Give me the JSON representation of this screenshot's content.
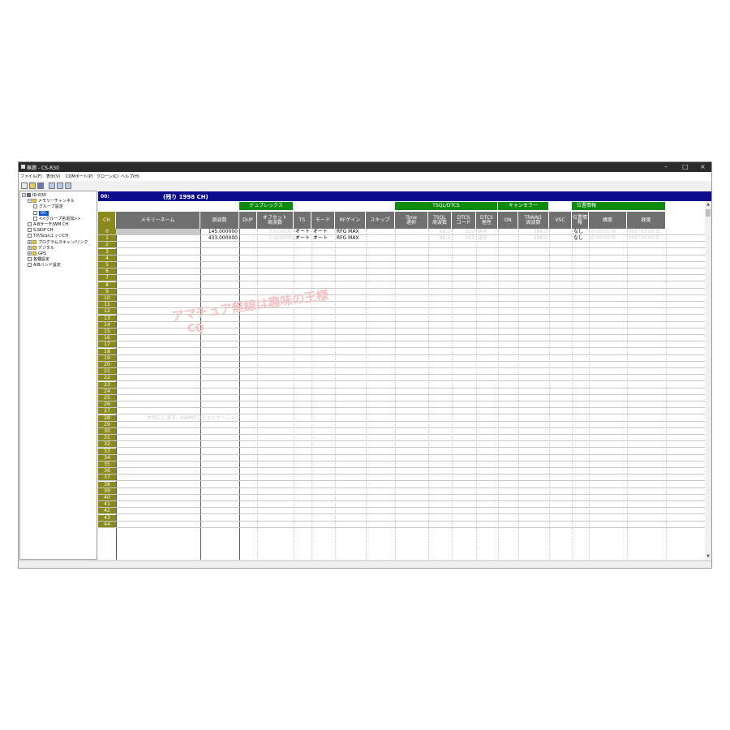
{
  "window": {
    "title": "無題 - CS-R30",
    "minimize": "–",
    "maximize": "□",
    "close": "×"
  },
  "menu": [
    "ファイル(F)",
    "表示(V)",
    "COMポート(P)",
    "クローン(C)",
    "ヘルプ(H)"
  ],
  "tree": [
    {
      "label": "ID-R30",
      "indent": 0,
      "icon": "radio",
      "expand": "−"
    },
    {
      "label": "メモリーチャンネル",
      "indent": 1,
      "icon": "folder",
      "expand": "−"
    },
    {
      "label": "グループ設定",
      "indent": 2,
      "icon": "page"
    },
    {
      "label": "00:",
      "indent": 2,
      "icon": "page",
      "selected": true
    },
    {
      "label": "<<グループ名追加>>",
      "indent": 2,
      "icon": "page"
    },
    {
      "label": "A-Bサーチ/WM CH",
      "indent": 1,
      "icon": "page"
    },
    {
      "label": "S.SKIP CH",
      "indent": 1,
      "icon": "page"
    },
    {
      "label": "T.P/ScanエッジCH",
      "indent": 1,
      "icon": "page"
    },
    {
      "label": "プログラムスキャン/リンク",
      "indent": 1,
      "icon": "folder",
      "expand": "+"
    },
    {
      "label": "デジタル",
      "indent": 1,
      "icon": "folder",
      "expand": "+"
    },
    {
      "label": "GPS",
      "indent": 1,
      "icon": "folder",
      "expand": "+"
    },
    {
      "label": "各種設定",
      "indent": 1,
      "icon": "page"
    },
    {
      "label": "A/Bバンド設定",
      "indent": 1,
      "icon": "page"
    }
  ],
  "header": {
    "group": "00:",
    "remaining": "(残り 1998 CH)"
  },
  "group_headers": [
    "デュプレックス",
    "TSQL/DTCS",
    "キャンセラー",
    "位置情報"
  ],
  "columns": [
    "CH",
    "メモリーネーム",
    "周波数",
    "DUP",
    "オフセット\n周波数",
    "TS",
    "モード",
    "RFゲイン",
    "スキップ",
    "Tone\n選択",
    "TSQL\n周波数",
    "DTCS\nコード",
    "DTCS\n極性",
    "ON",
    "TRAIN1\n周波数",
    "VSC",
    "位置情報",
    "緯度",
    "経度"
  ],
  "rows": [
    {
      "ch": "0",
      "freq": "145.000000",
      "offset": "0.600000",
      "ts": "オート",
      "mode": "オート",
      "rfgain": "RFG MAX",
      "tsql": "88.5",
      "dtcs": "023",
      "pol": "通常",
      "train": "288.0",
      "pos": "なし",
      "lat": "0°00'00\"N",
      "lon": "000°00'00\"E"
    },
    {
      "ch": "1",
      "freq": "433.000000",
      "offset": "5.000000",
      "ts": "オート",
      "mode": "オート",
      "rfgain": "RFG MAX",
      "tsql": "88.5",
      "dtcs": "023",
      "pol": "通常",
      "train": "288.0",
      "pos": "なし",
      "lat": "0°00'00\"N",
      "lon": "000°00'00\"E"
    },
    {
      "ch": "2"
    },
    {
      "ch": "3"
    },
    {
      "ch": "4"
    },
    {
      "ch": "5"
    },
    {
      "ch": "6"
    },
    {
      "ch": "7"
    },
    {
      "ch": "8"
    },
    {
      "ch": "9"
    },
    {
      "ch": "10"
    },
    {
      "ch": "11"
    },
    {
      "ch": "12"
    },
    {
      "ch": "13"
    },
    {
      "ch": "14"
    },
    {
      "ch": "15"
    },
    {
      "ch": "16"
    },
    {
      "ch": "17"
    },
    {
      "ch": "18"
    },
    {
      "ch": "19"
    },
    {
      "ch": "20"
    },
    {
      "ch": "21"
    },
    {
      "ch": "22"
    },
    {
      "ch": "23"
    },
    {
      "ch": "24"
    },
    {
      "ch": "25"
    },
    {
      "ch": "26"
    },
    {
      "ch": "27"
    },
    {
      "ch": "28"
    },
    {
      "ch": "29"
    },
    {
      "ch": "30"
    },
    {
      "ch": "31"
    },
    {
      "ch": "32"
    },
    {
      "ch": "33"
    },
    {
      "ch": "34"
    },
    {
      "ch": "35"
    },
    {
      "ch": "36"
    },
    {
      "ch": "37"
    },
    {
      "ch": "38"
    },
    {
      "ch": "39"
    },
    {
      "ch": "40"
    },
    {
      "ch": "41"
    },
    {
      "ch": "42"
    },
    {
      "ch": "43"
    },
    {
      "ch": "44"
    }
  ],
  "watermark": {
    "line1": "アマチュア無線は趣味の王様",
    "line2": "CQ",
    "line3": "大切にします、HAMのコミュニケーション"
  },
  "colors": {
    "header_bar": "#0c0c8c",
    "group_green": "#0e8a0e",
    "ch_olive": "#8a8a1c",
    "col_header_gray": "#707070"
  }
}
